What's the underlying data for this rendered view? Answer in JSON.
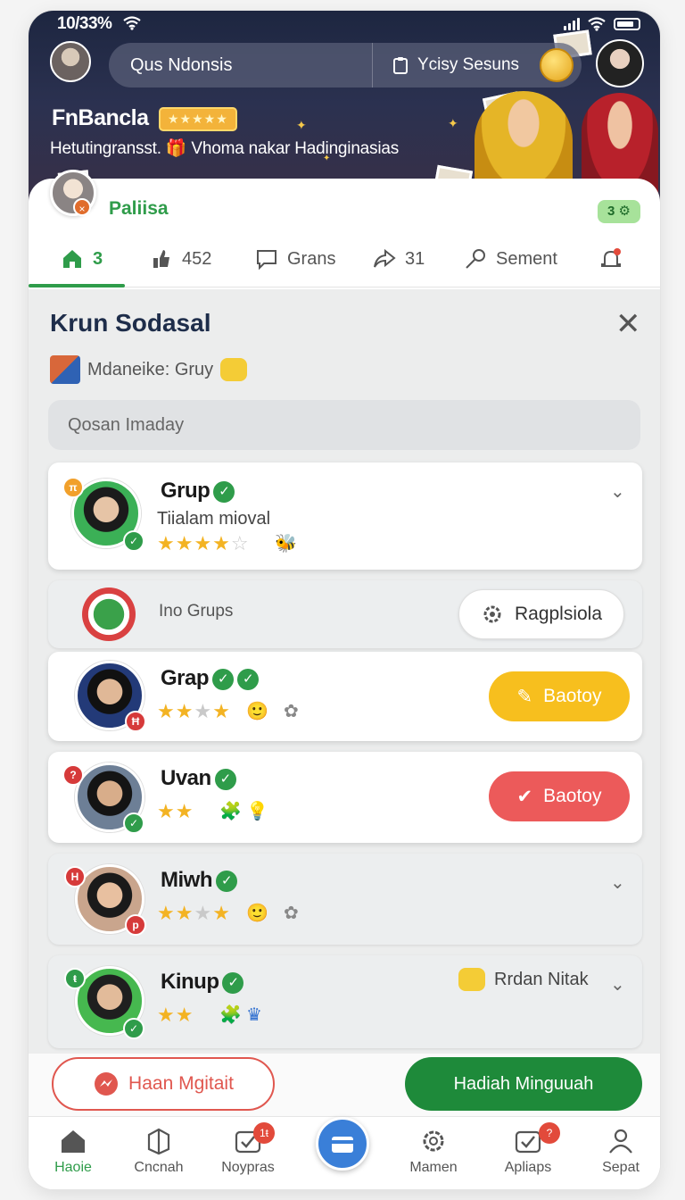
{
  "status": {
    "time": "10/33%"
  },
  "header": {
    "search_text": "Qus Ndonsis",
    "filter_label": "Ycisy Sesuns",
    "brand_title": "FnBancla",
    "brand_badge": "★★★★★",
    "tagline": "Hetutingransst. 🎁 Vhoma nakar Hadinginasias"
  },
  "profile": {
    "name": "Paliisa",
    "pill": "3 ⚙"
  },
  "tabs": [
    {
      "label": "3",
      "icon": "home-icon"
    },
    {
      "label": "452",
      "icon": "thumb-icon"
    },
    {
      "label": "Grans",
      "icon": "chat-icon"
    },
    {
      "label": "31",
      "icon": "share-icon"
    },
    {
      "label": "Sement",
      "icon": "key-icon"
    }
  ],
  "panel": {
    "title": "Krun Sodasal",
    "subtitle": "Mdaneike: Gruy",
    "search_placeholder": "Qosan Imaday",
    "close_label": "✕"
  },
  "groups": [
    {
      "name": "Grup",
      "subtitle": "Tiialam mioval",
      "rating": 4,
      "corner_badge": "π"
    },
    {
      "name": "Grap",
      "rating": 3,
      "corner_badge": "Ħ",
      "action_label": "Baotoy",
      "action_color": "#f7bf1e"
    },
    {
      "name": "Uvan",
      "rating": 2,
      "corner_badge": "?",
      "action_label": "Baotoy",
      "action_color": "#ec5a5a"
    },
    {
      "name": "Miwh",
      "rating": 3,
      "corner_badge": "H",
      "badge_right": "p"
    },
    {
      "name": "Kinup",
      "rating": 2,
      "corner_badge": "ŧ",
      "side_label": "Rrdan Nitak"
    }
  ],
  "info_row": {
    "label": "Ino Grups",
    "button_label": "Ragplsiola"
  },
  "actions": {
    "help_label": "Haan Mgitait",
    "claim_label": "Hadiah Minguuah"
  },
  "bottom_nav": [
    {
      "label": "Haoie",
      "icon": "home-icon"
    },
    {
      "label": "Cncnah",
      "icon": "box-icon"
    },
    {
      "label": "Noypras",
      "icon": "check-icon",
      "badge": "1ŧ"
    },
    {
      "label": "",
      "icon": "wallet-icon"
    },
    {
      "label": "Mamen",
      "icon": "settings-icon"
    },
    {
      "label": "Apliaps",
      "icon": "check-box-icon",
      "badge": "?"
    },
    {
      "label": "Sepat",
      "icon": "user-icon"
    }
  ],
  "colors": {
    "accent": "#2f9c4a",
    "claim": "#1e8a3a",
    "help": "#e0574f"
  }
}
